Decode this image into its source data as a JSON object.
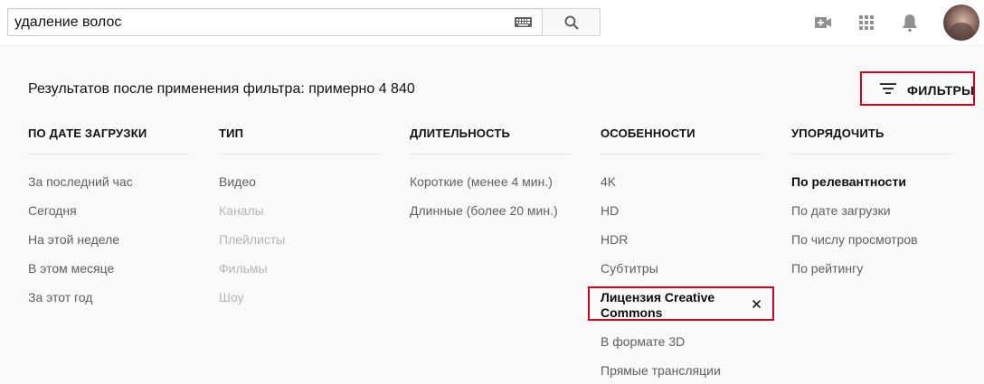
{
  "search": {
    "query": "удаление волос",
    "keyboard_icon": "keyboard-icon",
    "search_icon": "search-icon"
  },
  "header_icons": [
    "video-camera-plus-icon",
    "apps-grid-icon",
    "bell-icon",
    "avatar"
  ],
  "results": {
    "summary": "Результатов после применения фильтра: примерно 4 840"
  },
  "filters_button": {
    "label": "ФИЛЬТРЫ",
    "icon": "filter-icon"
  },
  "columns": [
    {
      "title": "ПО ДАТЕ ЗАГРУЗКИ",
      "options": [
        {
          "label": "За последний час"
        },
        {
          "label": "Сегодня"
        },
        {
          "label": "На этой неделе"
        },
        {
          "label": "В этом месяце"
        },
        {
          "label": "За этот год"
        }
      ]
    },
    {
      "title": "ТИП",
      "options": [
        {
          "label": "Видео"
        },
        {
          "label": "Каналы",
          "disabled": true
        },
        {
          "label": "Плейлисты",
          "disabled": true
        },
        {
          "label": "Фильмы",
          "disabled": true
        },
        {
          "label": "Шоу",
          "disabled": true
        }
      ]
    },
    {
      "title": "ДЛИТЕЛЬНОСТЬ",
      "options": [
        {
          "label": "Короткие (менее 4 мин.)"
        },
        {
          "label": "Длинные (более 20 мин.)"
        }
      ]
    },
    {
      "title": "ОСОБЕННОСТИ",
      "options": [
        {
          "label": "4K"
        },
        {
          "label": "HD"
        },
        {
          "label": "HDR"
        },
        {
          "label": "Субтитры"
        },
        {
          "label": "Лицензия Creative Commons",
          "selected": true
        },
        {
          "label": "В формате 3D"
        },
        {
          "label": "Прямые трансляции"
        }
      ]
    },
    {
      "title": "УПОРЯДОЧИТЬ",
      "options": [
        {
          "label": "По релевантности",
          "selected": true
        },
        {
          "label": "По дате загрузки"
        },
        {
          "label": "По числу просмотров"
        },
        {
          "label": "По рейтингу"
        }
      ]
    }
  ],
  "colors": {
    "highlight_border": "#d0021b",
    "text_secondary": "#606060",
    "text_disabled": "#b5b5b5",
    "background": "#f9f9f9"
  }
}
